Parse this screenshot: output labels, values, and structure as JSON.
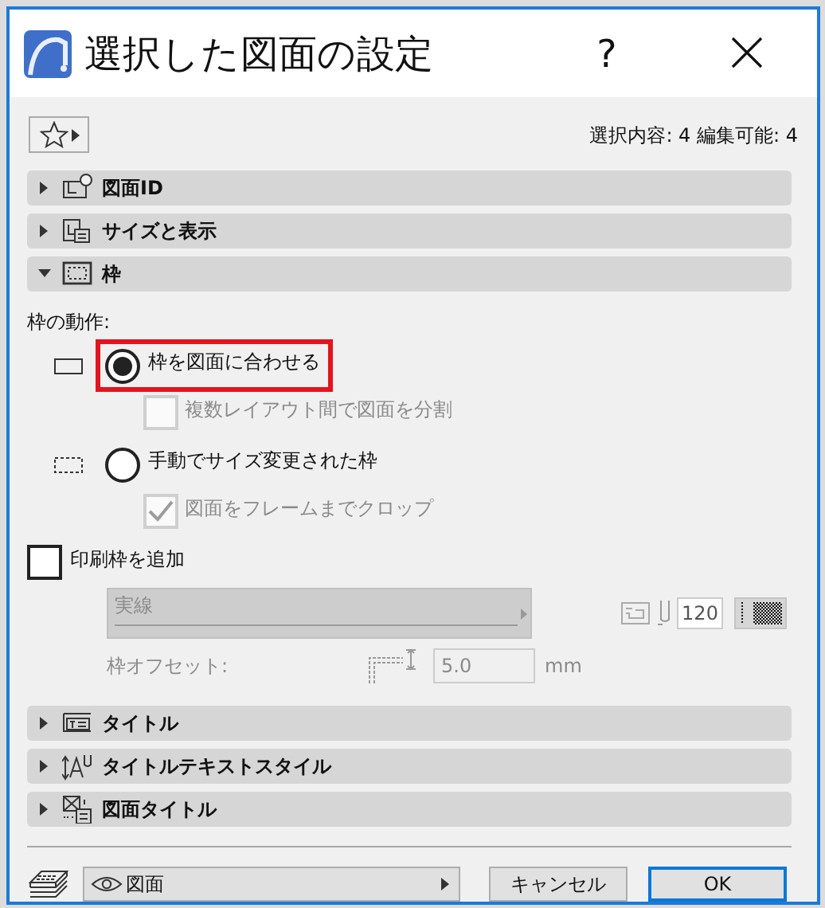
{
  "window": {
    "title": "選択した図面の設定",
    "help": "?"
  },
  "favorites": {
    "kind": "star"
  },
  "summary": "選択内容: 4 編集可能: 4",
  "sections": [
    {
      "label": "図面ID",
      "kind": "id",
      "expanded": false
    },
    {
      "label": "サイズと表示",
      "kind": "size",
      "expanded": false
    },
    {
      "label": "枠",
      "kind": "frame",
      "expanded": true
    },
    {
      "label": "タイトル",
      "kind": "title",
      "expanded": false
    },
    {
      "label": "タイトルテキストスタイル",
      "kind": "text-style",
      "expanded": false
    },
    {
      "label": "図面タイトル",
      "kind": "drawing-title",
      "expanded": false
    }
  ],
  "frame_settings": {
    "label": "枠の動作:",
    "options": [
      {
        "label": "枠を図面に合わせる",
        "kind": "solid",
        "selected": true,
        "highlighted": true,
        "sub_option": {
          "label": "複数レイアウト間で図面を分割",
          "checked": false,
          "disabled": true
        }
      },
      {
        "label": "手動でサイズ変更された枠",
        "kind": "dashed",
        "selected": false,
        "highlighted": false,
        "sub_option": {
          "label": "図面をフレームまでクロップ",
          "checked": true,
          "disabled": true
        }
      }
    ],
    "print_frame": {
      "label": "印刷枠を追加",
      "checked": false
    },
    "line_type": {
      "value": "実線",
      "disabled": true
    },
    "pen": {
      "value": "120"
    },
    "offset": {
      "label": "枠オフセット:",
      "value": "5.0",
      "unit": "mm",
      "disabled": true
    }
  },
  "footer": {
    "layer_field": {
      "value": "図面"
    },
    "buttons": [
      {
        "label": "キャンセル",
        "default": false
      },
      {
        "label": "OK",
        "default": true
      }
    ]
  }
}
